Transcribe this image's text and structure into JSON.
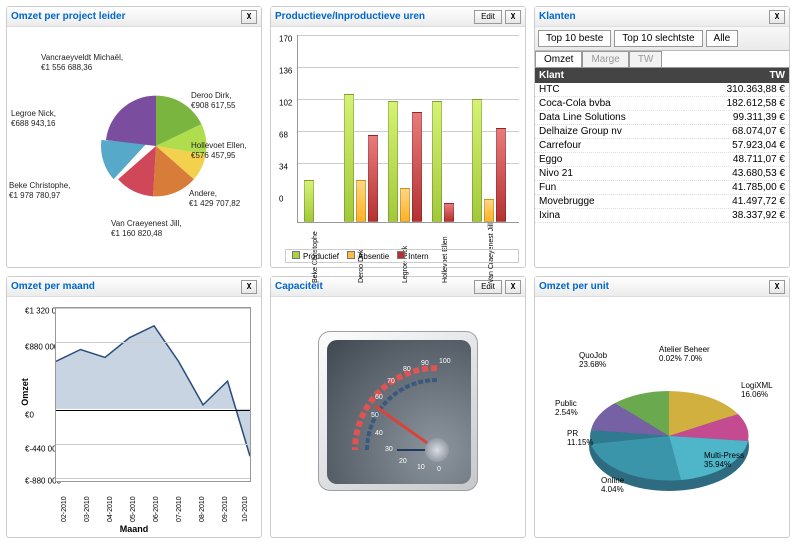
{
  "panels": {
    "pie1": {
      "title": "Omzet per project leider"
    },
    "bars": {
      "title": "Productieve/Inproductieve uren",
      "edit": "Edit"
    },
    "klanten": {
      "title": "Klanten"
    },
    "line": {
      "title": "Omzet per maand"
    },
    "cap": {
      "title": "Capaciteit",
      "edit": "Edit"
    },
    "pie2": {
      "title": "Omzet per unit"
    }
  },
  "btn_close": "X",
  "pie1_labels": {
    "vancraeyveldt": "Vancraeyveldt Michaël,\n€1 556 688,36",
    "legroe": "Legroe Nick,\n€688 943,16",
    "beke": "Beke Christophe,\n€1 978 780,97",
    "vancraeyenest": "Van Craeyenest Jill,\n€1 160 820,48",
    "andere": "Andere,\n€1 429 707,82",
    "hollevoet": "Hollevoet Ellen,\n€576 457,95",
    "deroo": "Deroo Dirk,\n€908 617,55"
  },
  "bar_yticks": [
    "170",
    "136",
    "102",
    "68",
    "34",
    "0"
  ],
  "bar_cats": [
    "Beke Christophe",
    "Deroo Dirk",
    "Legroe Nick",
    "Hollevoet Ellen",
    "Van Craeyenest Jill"
  ],
  "bar_legend": {
    "g": "Productief",
    "o": "Absentie",
    "r": "Intern"
  },
  "klanten_tabs": {
    "a": "Top 10 beste",
    "b": "Top 10 slechtste",
    "c": "Alle"
  },
  "klanten_subtabs": {
    "a": "Omzet",
    "b": "Marge",
    "c": "TW"
  },
  "klanten_head": {
    "k": "Klant",
    "t": "TW"
  },
  "klanten_rows": [
    {
      "k": "HTC",
      "t": "310.363,88 €"
    },
    {
      "k": "Coca-Cola bvba",
      "t": "182.612,58 €"
    },
    {
      "k": "Data Line Solutions",
      "t": "99.311,39 €"
    },
    {
      "k": "Delhaize Group nv",
      "t": "68.074,07 €"
    },
    {
      "k": "Carrefour",
      "t": "57.923,04 €"
    },
    {
      "k": "Eggo",
      "t": "48.711,07 €"
    },
    {
      "k": "Nivo 21",
      "t": "43.680,53 €"
    },
    {
      "k": "Fun",
      "t": "41.785,00 €"
    },
    {
      "k": "Movebrugge",
      "t": "41.497,72 €"
    },
    {
      "k": "Ixina",
      "t": "38.337,92 €"
    }
  ],
  "line_yticks": [
    "€1 320 000",
    "€880 000",
    "€0",
    "€-440 000",
    "€-880 000"
  ],
  "line_xticks": [
    "02-2010",
    "03-2010",
    "04-2010",
    "05-2010",
    "06-2010",
    "07-2010",
    "08-2010",
    "09-2010",
    "10-2010"
  ],
  "line_ylabel": "Omzet",
  "line_xlabel": "Maand",
  "gauge_ticks": [
    "0",
    "10",
    "20",
    "30",
    "40",
    "50",
    "60",
    "70",
    "80",
    "90",
    "100"
  ],
  "pie2_labels": {
    "quojob": "QuoJob\n23.68%",
    "public": "Public\n2.54%",
    "pr": "PR\n11.15%",
    "online": "Online\n4.04%",
    "multi": "Multi-Press\n35.94%",
    "logi": "LogiXML\n16.06%",
    "atelier": "Atelier Beheer\n0.02% 7.0%"
  },
  "chart_data": [
    {
      "type": "pie",
      "title": "Omzet per project leider",
      "series": [
        {
          "name": "Vancraeyveldt Michaël",
          "value": 1556688.36
        },
        {
          "name": "Legroe Nick",
          "value": 688943.16
        },
        {
          "name": "Beke Christophe",
          "value": 1978780.97
        },
        {
          "name": "Van Craeyenest Jill",
          "value": 1160820.48
        },
        {
          "name": "Andere",
          "value": 1429707.82
        },
        {
          "name": "Hollevoet Ellen",
          "value": 576457.95
        },
        {
          "name": "Deroo Dirk",
          "value": 908617.55
        }
      ]
    },
    {
      "type": "bar",
      "title": "Productieve/Inproductieve uren",
      "ylim": [
        0,
        170
      ],
      "categories": [
        "Beke Christophe",
        "Deroo Dirk",
        "Legroe Nick",
        "Hollevoet Ellen",
        "Van Craeyenest Jill"
      ],
      "series": [
        {
          "name": "Productief",
          "values": [
            44,
            136,
            128,
            128,
            130
          ]
        },
        {
          "name": "Absentie",
          "values": [
            0,
            44,
            36,
            0,
            24
          ]
        },
        {
          "name": "Intern",
          "values": [
            0,
            92,
            116,
            20,
            100
          ]
        }
      ]
    },
    {
      "type": "line",
      "title": "Omzet per maand",
      "xlabel": "Maand",
      "ylabel": "Omzet",
      "ylim": [
        -880000,
        1320000
      ],
      "categories": [
        "02-2010",
        "03-2010",
        "04-2010",
        "05-2010",
        "06-2010",
        "07-2010",
        "08-2010",
        "09-2010",
        "10-2010"
      ],
      "values": [
        650000,
        800000,
        700000,
        950000,
        1100000,
        650000,
        50000,
        350000,
        -600000
      ]
    },
    {
      "type": "pie",
      "title": "Omzet per unit",
      "series": [
        {
          "name": "QuoJob",
          "value": 23.68
        },
        {
          "name": "Public",
          "value": 2.54
        },
        {
          "name": "PR",
          "value": 11.15
        },
        {
          "name": "Online",
          "value": 4.04
        },
        {
          "name": "Multi-Press",
          "value": 35.94
        },
        {
          "name": "LogiXML",
          "value": 16.06
        },
        {
          "name": "Atelier",
          "value": 0.02
        },
        {
          "name": "Beheer",
          "value": 7.0
        }
      ]
    }
  ]
}
